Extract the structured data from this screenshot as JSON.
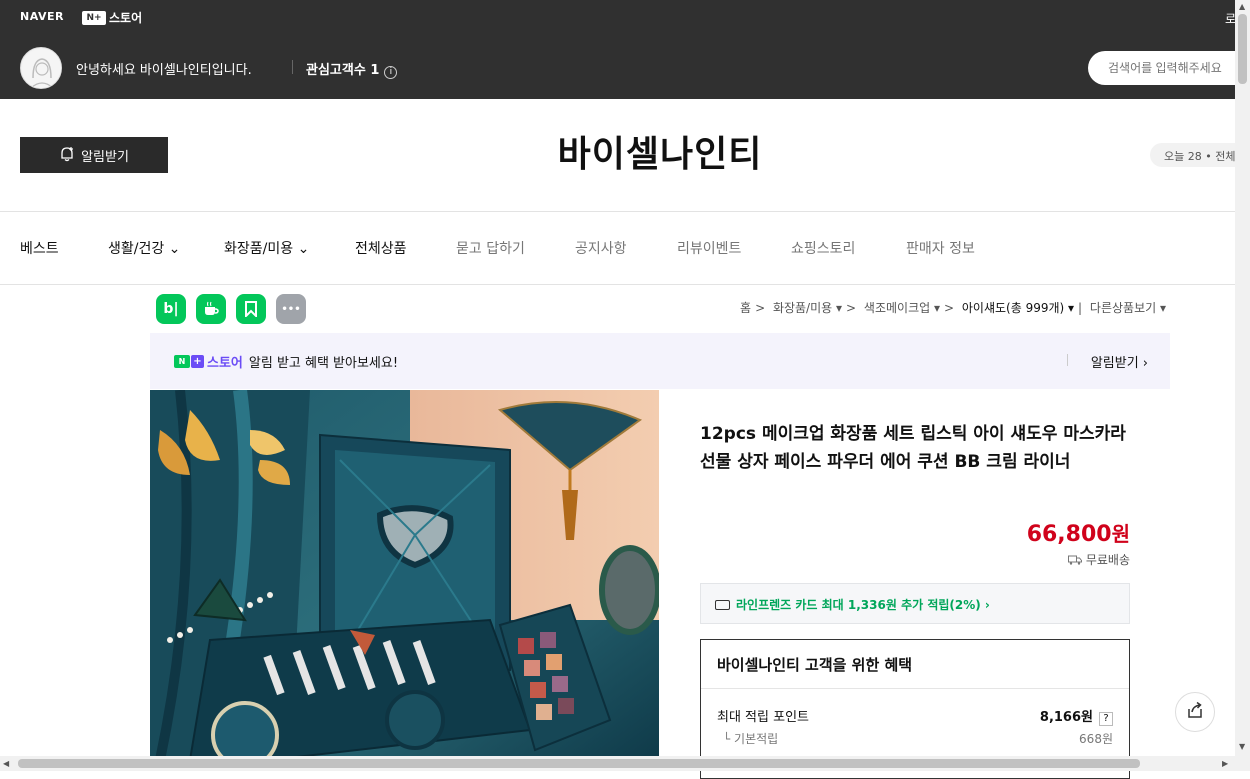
{
  "topbar": {
    "naver": "NAVER",
    "nplus_box": "N+",
    "nplus_text": "스토어",
    "right_text": "로"
  },
  "store": {
    "greeting": "안녕하세요 바이셀나인티입니다.",
    "fans_label": "관심고객수 1",
    "search_placeholder": "검색어를 입력해주세요",
    "alarm_label": "알림받기",
    "title": "바이셀나인티",
    "visitors": "오늘 28 • 전체"
  },
  "nav": {
    "items": [
      {
        "label": "베스트"
      },
      {
        "label": "생활/건강 ⌄"
      },
      {
        "label": "화장품/미용 ⌄"
      },
      {
        "label": "전체상품"
      },
      {
        "label": "묻고 답하기"
      },
      {
        "label": "공지사항"
      },
      {
        "label": "리뷰이벤트"
      },
      {
        "label": "쇼핑스토리"
      },
      {
        "label": "판매자 정보"
      }
    ]
  },
  "sns": [
    {
      "icon": "blog-icon",
      "glyph": "b|",
      "color": "#03c75a"
    },
    {
      "icon": "talk-icon",
      "glyph": "☕",
      "color": "#03c75a"
    },
    {
      "icon": "bookmark-icon",
      "glyph": "K",
      "color": "#03c75a"
    },
    {
      "icon": "more-icon",
      "glyph": "•••",
      "color": "#a0a4aa"
    }
  ],
  "breadcrumb": {
    "home": "홈",
    "c1": "화장품/미용 ▾",
    "c2": "색조메이크업 ▾",
    "c3": "아이섀도(총 999개) ▾",
    "other": "다른상품보기 ▾"
  },
  "banner": {
    "store": "스토어",
    "text": "알림 받고 혜택 받아보세요!",
    "action": "알림받기 ›"
  },
  "product": {
    "title": "12pcs 메이크업 화장품 세트 립스틱 아이 섀도우 마스카라 선물 상자 페이스 파우더 에어 쿠션 BB 크림 라이너",
    "price": "66,800",
    "won": "원",
    "shipping": "무료배송",
    "card_text": "라인프렌즈 카드 최대 1,336원 추가 적립(2%) ›"
  },
  "benefit": {
    "heading": "바이셀나인티 고객을 위한 혜택",
    "max_label": "최대 적립 포인트",
    "max_value": "8,166원",
    "qm": "?",
    "basic_label": "└ 기본적립",
    "basic_value": "668원"
  },
  "colors": {
    "header_bg": "#303030",
    "price": "#d0021b",
    "green": "#03c75a",
    "banner_bg": "#f4f3fc"
  }
}
